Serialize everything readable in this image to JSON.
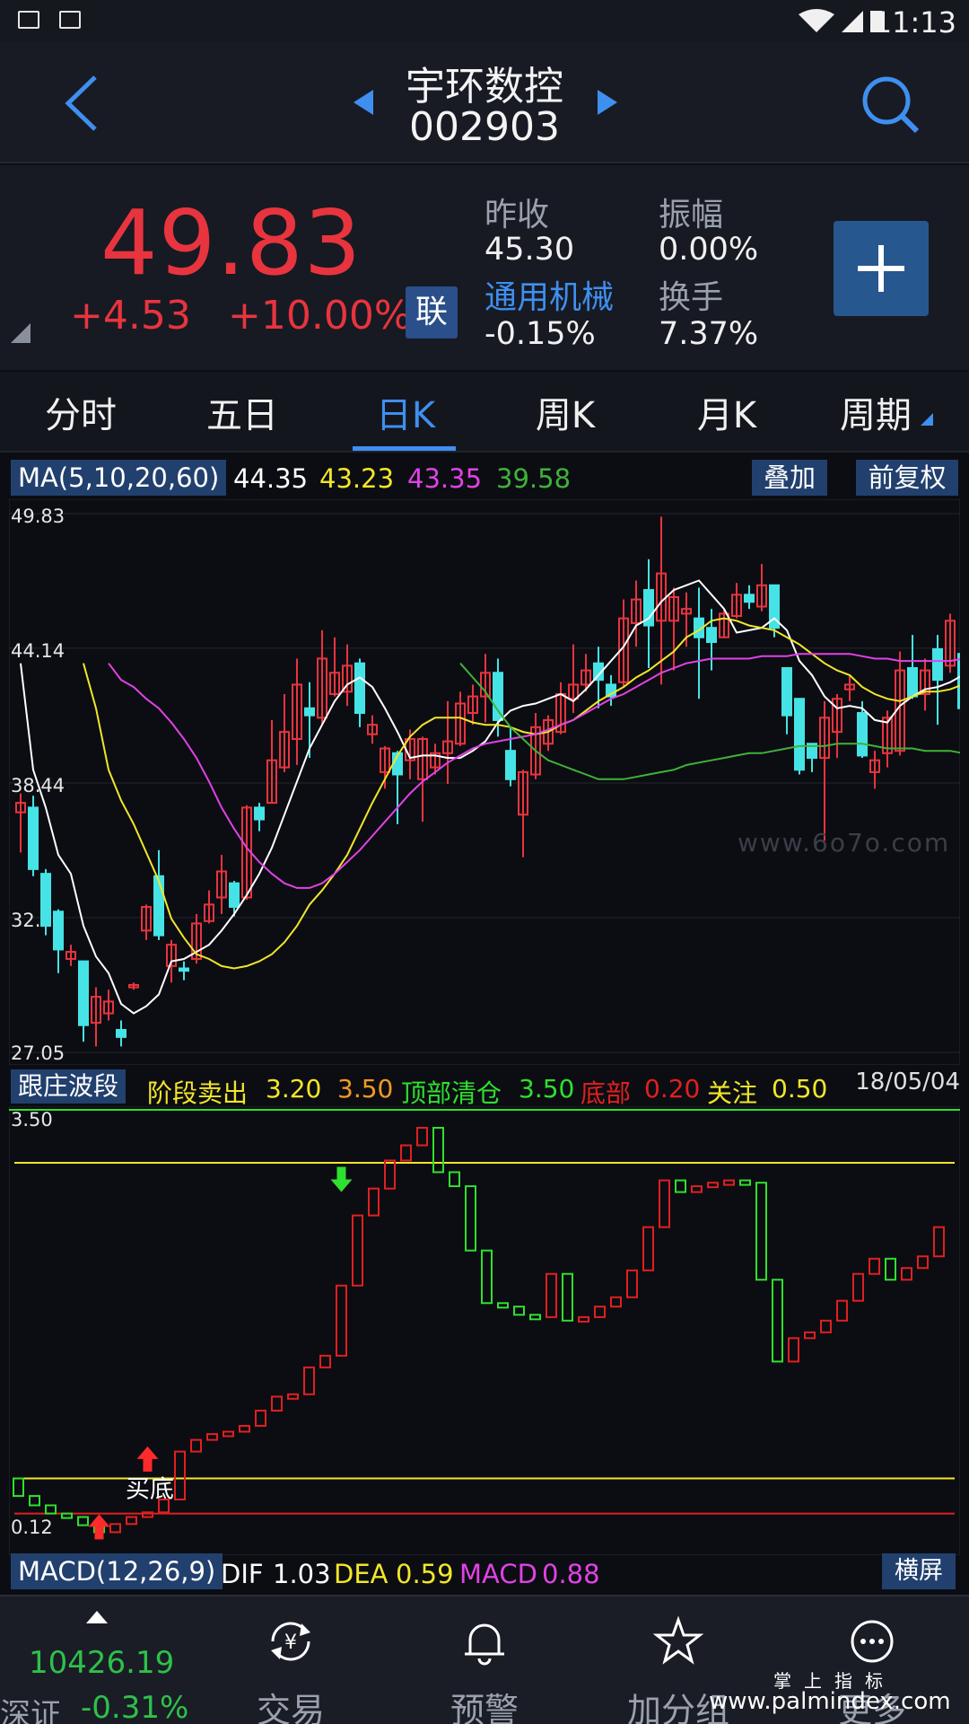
{
  "status_bar": {
    "time": "11:13"
  },
  "header": {
    "stock_name": "宇环数控",
    "stock_code": "002903"
  },
  "quote": {
    "price": "49.83",
    "change": "+4.53",
    "change_pct": "+10.00%",
    "badge": "联",
    "prev_close_label": "昨收",
    "prev_close": "45.30",
    "amplitude_label": "振幅",
    "amplitude": "0.00%",
    "industry": "通用机械",
    "industry_change": "-0.15%",
    "turnover_label": "换手",
    "turnover": "7.37%"
  },
  "tabs": [
    {
      "label": "分时",
      "active": false
    },
    {
      "label": "五日",
      "active": false
    },
    {
      "label": "日K",
      "active": true
    },
    {
      "label": "周K",
      "active": false
    },
    {
      "label": "月K",
      "active": false
    },
    {
      "label": "周期",
      "active": false
    }
  ],
  "ma_legend": {
    "label": "MA(5,10,20,60)",
    "ma5": "44.35",
    "ma10": "43.23",
    "ma20": "43.35",
    "ma60": "39.58",
    "overlay_button": "叠加",
    "adjust_button": "前复权"
  },
  "colors": {
    "up": "#e8343f",
    "down": "#46e3e6",
    "ma5": "#ffffff",
    "ma10": "#f1e62a",
    "ma20": "#e042e6",
    "ma60": "#3fb23a",
    "accent": "#3f8ff0",
    "ind_up": "#e02020",
    "ind_down": "#2fe02f"
  },
  "indicator_legend": {
    "label": "跟庄波段",
    "sell_label": "阶段卖出",
    "sell_v1": "3.20",
    "sell_v2": "3.50",
    "top_label": "顶部清仓",
    "top_v": "3.50",
    "bottom_label": "底部",
    "bottom_v": "0.20",
    "watch_label": "关注",
    "watch_v": "0.50",
    "date": "18/05/04",
    "buy_signal": "买底"
  },
  "macd_legend": {
    "label": "MACD(12,26,9)",
    "dif_label": "DIF",
    "dif": "1.03",
    "dea_label": "DEA",
    "dea": "0.59",
    "macd_label": "MACD",
    "macd": "0.88",
    "landscape_button": "横屏"
  },
  "bottom_nav": {
    "index_value": "10426.19",
    "index_name": "深证",
    "index_change": "-0.31%",
    "items": [
      "交易",
      "预警",
      "加分组",
      "更多"
    ]
  },
  "watermarks": {
    "chart": "www.6o7o.com",
    "brand": "掌上指标",
    "site": "www.palmindex.com"
  },
  "chart_data": [
    {
      "type": "candlestick",
      "title": "",
      "y_ticks": [
        "49.83",
        "44.14",
        "38.44",
        "32.75",
        "27.05"
      ],
      "ylim": [
        27.05,
        49.83
      ],
      "series_names": [
        "MA5",
        "MA10",
        "MA20",
        "MA60"
      ],
      "candles": [
        [
          37.2,
          37.6,
          35.5,
          38.0
        ],
        [
          37.4,
          34.8,
          34.5,
          37.9
        ],
        [
          34.6,
          32.4,
          32.0,
          34.8
        ],
        [
          33.0,
          31.4,
          30.4,
          33.1
        ],
        [
          31.0,
          31.3,
          30.7,
          31.6
        ],
        [
          30.9,
          28.2,
          27.5,
          30.9
        ],
        [
          28.3,
          29.4,
          27.3,
          29.8
        ],
        [
          28.7,
          29.2,
          28.4,
          29.7
        ],
        [
          28.0,
          27.7,
          27.3,
          28.4
        ],
        [
          29.8,
          29.9,
          29.7,
          30.0
        ],
        [
          32.2,
          33.2,
          31.8,
          33.3
        ],
        [
          34.5,
          32.0,
          31.8,
          35.6
        ],
        [
          30.7,
          31.6,
          30.0,
          31.8
        ],
        [
          30.6,
          30.5,
          30.1,
          30.9
        ],
        [
          31.0,
          32.5,
          30.8,
          32.9
        ],
        [
          32.6,
          33.3,
          32.5,
          33.9
        ],
        [
          33.6,
          34.7,
          32.9,
          35.4
        ],
        [
          34.2,
          33.2,
          32.8,
          34.3
        ],
        [
          33.6,
          37.4,
          33.5,
          37.5
        ],
        [
          37.4,
          36.9,
          36.4,
          37.6
        ],
        [
          37.6,
          39.4,
          37.6,
          41.1
        ],
        [
          39.1,
          40.6,
          38.9,
          42.2
        ],
        [
          40.3,
          42.6,
          39.2,
          43.7
        ],
        [
          41.6,
          41.3,
          39.5,
          42.7
        ],
        [
          41.2,
          43.7,
          40.9,
          44.9
        ],
        [
          42.2,
          43.1,
          42.1,
          44.6
        ],
        [
          42.3,
          43.4,
          41.7,
          44.3
        ],
        [
          43.5,
          41.4,
          40.8,
          43.7
        ],
        [
          40.5,
          40.9,
          40.1,
          41.3
        ],
        [
          38.9,
          39.9,
          38.2,
          40.0
        ],
        [
          39.7,
          38.8,
          36.7,
          39.8
        ],
        [
          39.4,
          40.3,
          38.6,
          40.7
        ],
        [
          38.6,
          40.3,
          36.8,
          40.4
        ],
        [
          39.1,
          39.7,
          38.8,
          40.1
        ],
        [
          39.7,
          40.2,
          38.4,
          41.9
        ],
        [
          40.1,
          41.8,
          40.0,
          42.3
        ],
        [
          41.4,
          42.1,
          40.9,
          42.6
        ],
        [
          42.1,
          43.1,
          41.0,
          43.9
        ],
        [
          43.1,
          41.1,
          40.4,
          43.7
        ],
        [
          39.8,
          38.6,
          38.3,
          40.8
        ],
        [
          37.1,
          38.9,
          35.3,
          39.0
        ],
        [
          38.8,
          40.8,
          38.6,
          41.4
        ],
        [
          40.1,
          41.1,
          39.8,
          41.3
        ],
        [
          40.6,
          42.2,
          40.5,
          42.7
        ],
        [
          42.0,
          42.6,
          41.4,
          44.3
        ],
        [
          42.6,
          43.2,
          42.3,
          43.9
        ],
        [
          43.5,
          42.8,
          41.6,
          44.2
        ],
        [
          42.6,
          42.1,
          41.7,
          43.0
        ],
        [
          42.7,
          45.4,
          42.5,
          46.2
        ],
        [
          45.2,
          46.2,
          44.2,
          47.0
        ],
        [
          46.6,
          45.1,
          43.3,
          47.9
        ],
        [
          45.3,
          47.3,
          42.6,
          49.7
        ],
        [
          45.3,
          46.3,
          43.2,
          46.7
        ],
        [
          45.6,
          45.8,
          44.2,
          46.5
        ],
        [
          45.4,
          44.6,
          42.0,
          46.7
        ],
        [
          45.0,
          44.4,
          43.2,
          45.8
        ],
        [
          44.6,
          45.6,
          44.6,
          45.8
        ],
        [
          45.5,
          46.4,
          45.4,
          46.9
        ],
        [
          46.4,
          46.1,
          45.8,
          46.8
        ],
        [
          45.9,
          46.8,
          45.7,
          47.7
        ],
        [
          46.8,
          45.0,
          44.6,
          46.8
        ],
        [
          43.3,
          41.3,
          40.5,
          43.3
        ],
        [
          42.0,
          39.0,
          38.8,
          42.0
        ],
        [
          40.1,
          39.5,
          38.9,
          40.1
        ],
        [
          39.5,
          41.2,
          36.0,
          41.9
        ],
        [
          40.6,
          42.0,
          39.5,
          42.2
        ],
        [
          42.4,
          42.6,
          41.9,
          43.0
        ],
        [
          41.4,
          39.6,
          39.5,
          41.9
        ],
        [
          38.9,
          39.4,
          38.2,
          39.8
        ],
        [
          39.7,
          41.2,
          39.1,
          41.5
        ],
        [
          39.8,
          43.2,
          39.6,
          44.0
        ],
        [
          43.3,
          42.1,
          42.0,
          44.7
        ],
        [
          42.2,
          43.2,
          41.5,
          43.7
        ],
        [
          44.1,
          42.8,
          40.9,
          44.7
        ],
        [
          43.4,
          45.3,
          43.1,
          45.6
        ],
        [
          43.9,
          41.6,
          40.6,
          44.3
        ],
        [
          41.6,
          41.4,
          40.4,
          44.7
        ]
      ],
      "ma5": [
        43.5,
        39.0,
        37.4,
        35.4,
        34.6,
        32.4,
        31.1,
        30.4,
        29.1,
        28.7,
        29.0,
        29.5,
        30.9,
        31.0,
        31.3,
        31.6,
        32.2,
        32.9,
        33.7,
        34.6,
        35.7,
        37.1,
        38.5,
        39.9,
        40.9,
        41.9,
        42.6,
        42.9,
        42.5,
        41.6,
        40.6,
        39.5,
        39.6,
        39.6,
        39.5,
        39.5,
        39.8,
        40.2,
        41.0,
        41.5,
        41.7,
        41.8,
        42.0,
        42.2,
        41.9,
        42.4,
        43.0,
        43.6,
        44.2,
        45.1,
        45.4,
        46.1,
        46.6,
        46.8,
        47.0,
        46.4,
        45.8,
        44.8,
        44.9,
        45.0,
        45.4,
        44.9,
        43.6,
        43.0,
        42.1,
        41.6,
        41.7,
        41.6,
        41.1,
        41.0,
        41.7,
        42.1,
        42.4,
        42.5,
        42.7,
        43.0,
        44.0
      ],
      "ma10": [
        43.5,
        41.6,
        39.0,
        37.7,
        36.7,
        35.5,
        34.3,
        32.7,
        31.9,
        31.2,
        31.0,
        30.7,
        30.6,
        30.7,
        30.9,
        31.2,
        31.7,
        32.4,
        33.3,
        33.9,
        34.6,
        35.4,
        36.5,
        37.6,
        38.6,
        39.6,
        40.4,
        40.9,
        41.2,
        41.2,
        41.2,
        41.0,
        40.9,
        40.9,
        40.8,
        40.6,
        40.5,
        40.6,
        40.9,
        41.1,
        41.5,
        41.9,
        42.2,
        42.5,
        42.9,
        43.2,
        43.6,
        44.0,
        44.6,
        44.9,
        45.3,
        45.4,
        45.3,
        45.1,
        45.0,
        44.9,
        44.6,
        44.3,
        43.9,
        43.5,
        43.2,
        43.0,
        42.5,
        42.2,
        42.0,
        41.9,
        42.1,
        42.3,
        42.3,
        42.4,
        42.6,
        42.6
      ],
      "ma20": [
        43.5,
        42.8,
        42.5,
        42.0,
        41.6,
        41.0,
        40.3,
        39.5,
        38.5,
        37.4,
        36.5,
        35.7,
        35.1,
        34.6,
        34.2,
        34.0,
        34.0,
        34.2,
        34.6,
        35.1,
        35.6,
        36.2,
        36.8,
        37.4,
        38.0,
        38.5,
        38.9,
        39.3,
        39.6,
        39.9,
        40.1,
        40.2,
        40.3,
        40.4,
        40.5,
        40.7,
        40.9,
        41.1,
        41.4,
        41.7,
        42.0,
        42.2,
        42.5,
        42.8,
        43.1,
        43.3,
        43.5,
        43.6,
        43.7,
        43.7,
        43.7,
        43.7,
        43.8,
        43.8,
        43.8,
        43.9,
        43.9,
        43.9,
        43.9,
        43.9,
        43.8,
        43.7,
        43.7,
        43.6,
        43.6,
        43.6,
        43.6,
        43.6,
        43.7,
        43.7
      ],
      "ma60": [
        43.5,
        42.9,
        42.3,
        41.5,
        40.8,
        40.3,
        39.8,
        39.4,
        39.2,
        39.0,
        38.8,
        38.6,
        38.6,
        38.6,
        38.7,
        38.8,
        38.9,
        39.0,
        39.2,
        39.3,
        39.4,
        39.5,
        39.6,
        39.7,
        39.7,
        39.8,
        39.9,
        40.0,
        40.0,
        40.0,
        40.1,
        40.1,
        40.1,
        40.0,
        39.9,
        39.9,
        39.9,
        39.8,
        39.8,
        39.8,
        39.7,
        39.8
      ]
    },
    {
      "type": "bar",
      "title": "",
      "y_ticks": [
        "3.50",
        "0.12"
      ],
      "ylim": [
        0.12,
        3.5
      ],
      "reference_lines": [
        3.2,
        0.5,
        0.2
      ],
      "bars": [
        [
          0.5,
          0.35
        ],
        [
          0.35,
          0.27
        ],
        [
          0.27,
          0.2
        ],
        [
          0.2,
          0.17
        ],
        [
          0.17,
          0.1
        ],
        [
          0.1,
          0.04
        ],
        [
          0.04,
          0.11
        ],
        [
          0.11,
          0.17
        ],
        [
          0.17,
          0.21
        ],
        [
          0.21,
          0.32
        ],
        [
          0.32,
          0.73
        ],
        [
          0.73,
          0.83
        ],
        [
          0.83,
          0.88
        ],
        [
          0.88,
          0.9
        ],
        [
          0.9,
          0.95
        ],
        [
          0.95,
          1.08
        ],
        [
          1.08,
          1.2
        ],
        [
          1.2,
          1.22
        ],
        [
          1.22,
          1.45
        ],
        [
          1.45,
          1.55
        ],
        [
          1.55,
          2.15
        ],
        [
          2.15,
          2.75
        ],
        [
          2.75,
          2.98
        ],
        [
          2.98,
          3.22
        ],
        [
          3.22,
          3.35
        ],
        [
          3.35,
          3.5
        ],
        [
          3.5,
          3.12
        ],
        [
          3.12,
          3.0
        ],
        [
          3.0,
          2.45
        ],
        [
          2.45,
          2.0
        ],
        [
          2.0,
          1.97
        ],
        [
          1.97,
          1.9
        ],
        [
          1.9,
          1.88
        ],
        [
          1.88,
          2.25
        ],
        [
          2.25,
          1.85
        ],
        [
          1.85,
          1.88
        ],
        [
          1.88,
          1.97
        ],
        [
          1.97,
          2.05
        ],
        [
          2.05,
          2.28
        ],
        [
          2.28,
          2.65
        ],
        [
          2.65,
          3.05
        ],
        [
          3.05,
          2.95
        ],
        [
          2.95,
          3.0
        ],
        [
          3.0,
          3.03
        ],
        [
          3.03,
          3.05
        ],
        [
          3.05,
          3.03
        ],
        [
          3.03,
          2.2
        ],
        [
          2.2,
          1.5
        ],
        [
          1.5,
          1.7
        ],
        [
          1.7,
          1.75
        ],
        [
          1.75,
          1.85
        ],
        [
          1.85,
          2.02
        ],
        [
          2.02,
          2.25
        ],
        [
          2.25,
          2.38
        ],
        [
          2.38,
          2.2
        ],
        [
          2.2,
          2.3
        ],
        [
          2.3,
          2.4
        ],
        [
          2.4,
          2.65
        ]
      ]
    }
  ]
}
